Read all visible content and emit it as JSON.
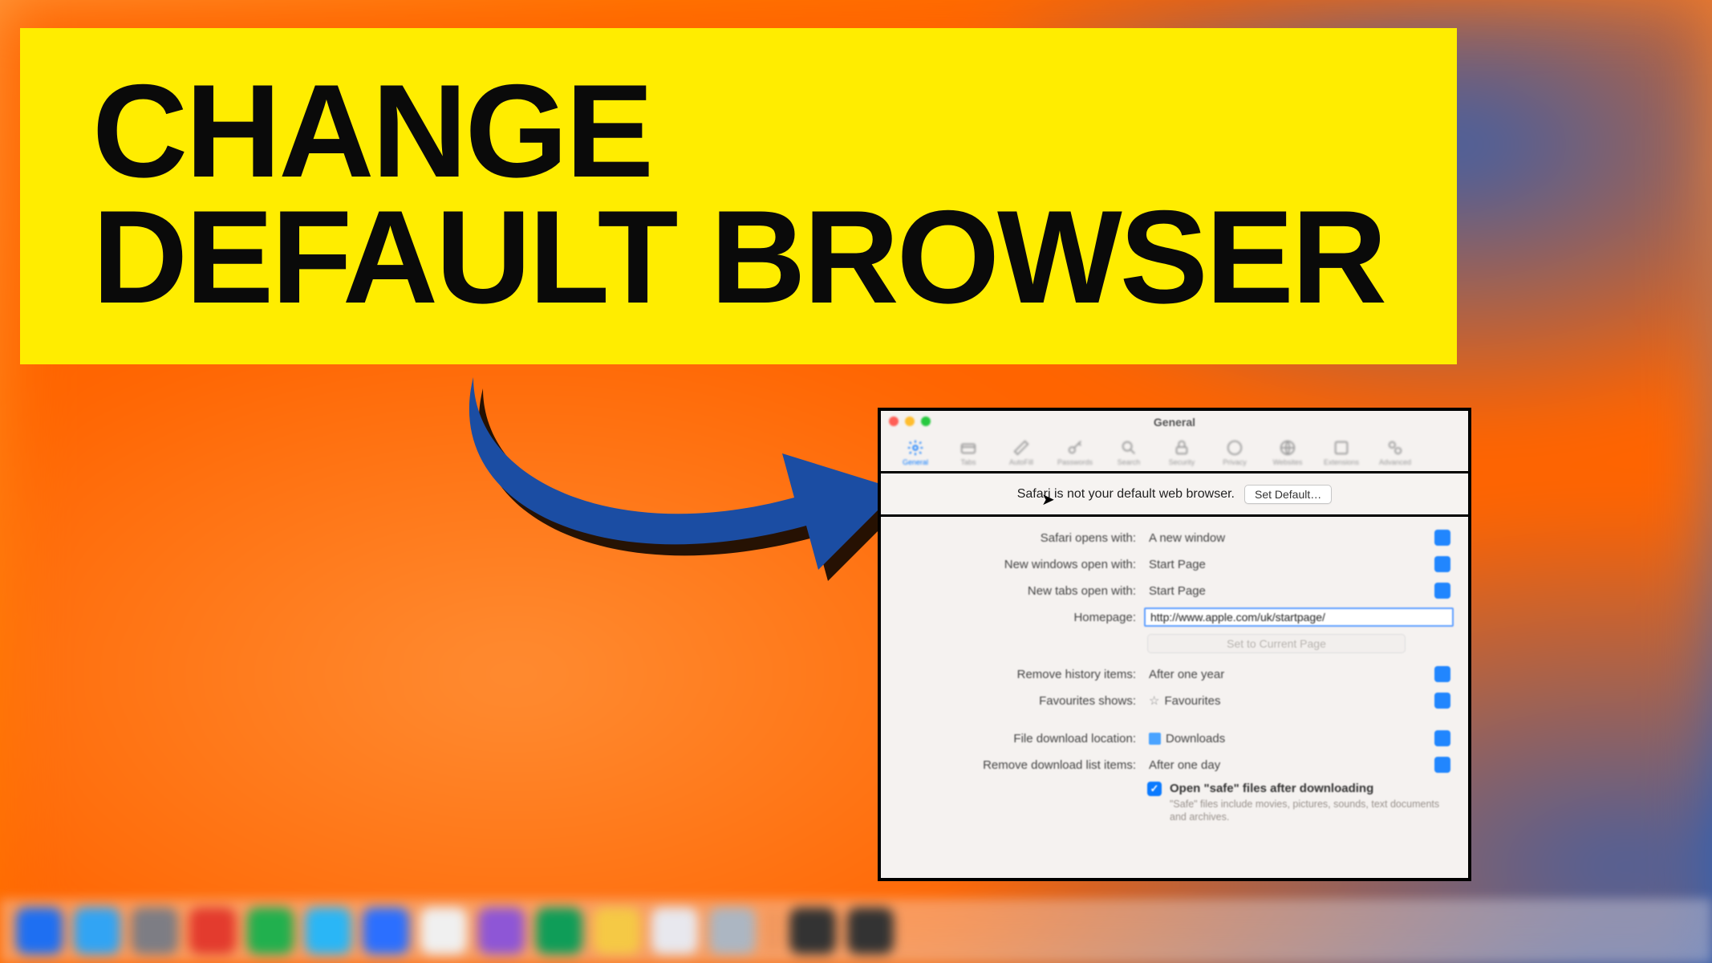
{
  "banner": {
    "line1": "CHANGE",
    "line2": "DEFAULT BROWSER"
  },
  "window": {
    "title": "General",
    "toolbar": [
      {
        "name": "general",
        "label": "General",
        "active": true
      },
      {
        "name": "tabs",
        "label": "Tabs"
      },
      {
        "name": "autofill",
        "label": "AutoFill"
      },
      {
        "name": "passwords",
        "label": "Passwords"
      },
      {
        "name": "search",
        "label": "Search"
      },
      {
        "name": "security",
        "label": "Security"
      },
      {
        "name": "privacy",
        "label": "Privacy"
      },
      {
        "name": "websites",
        "label": "Websites"
      },
      {
        "name": "extensions",
        "label": "Extensions"
      },
      {
        "name": "advanced",
        "label": "Advanced"
      }
    ],
    "default_banner": {
      "message": "Safari is not your default web browser.",
      "button": "Set Default…"
    },
    "rows": {
      "safari_opens_label": "Safari opens with:",
      "safari_opens_value": "A new window",
      "new_windows_label": "New windows open with:",
      "new_windows_value": "Start Page",
      "new_tabs_label": "New tabs open with:",
      "new_tabs_value": "Start Page",
      "homepage_label": "Homepage:",
      "homepage_value": "http://www.apple.com/uk/startpage/",
      "set_current_button": "Set to Current Page",
      "remove_history_label": "Remove history items:",
      "remove_history_value": "After one year",
      "favourites_label": "Favourites shows:",
      "favourites_value": "Favourites",
      "download_loc_label": "File download location:",
      "download_loc_value": "Downloads",
      "remove_downloads_label": "Remove download list items:",
      "remove_downloads_value": "After one day",
      "open_safe_label": "Open \"safe\" files after downloading",
      "open_safe_sub": "\"Safe\" files include movies, pictures, sounds, text documents and archives."
    }
  },
  "dock_colors": [
    "#1e6ff2",
    "#31a4f4",
    "#7d7d84",
    "#e33b2e",
    "#21b04e",
    "#2ab6f6",
    "#2b6fff",
    "#f0f0f0",
    "#8e56d6",
    "#0f9d58",
    "#f5c945",
    "#e8e8ee",
    "#acb6c2",
    "#333333",
    "#333333"
  ]
}
